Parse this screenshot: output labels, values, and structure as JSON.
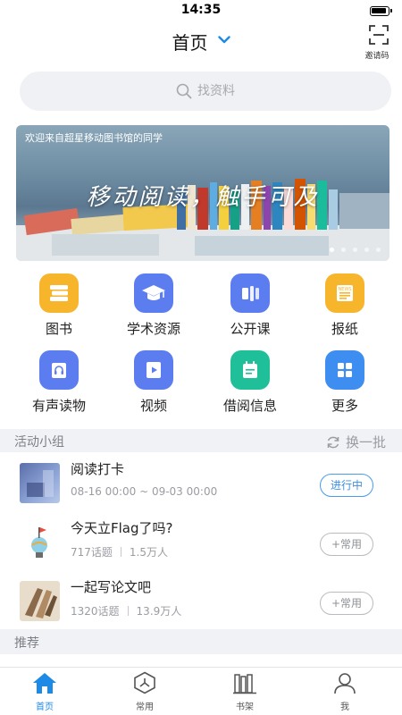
{
  "status_bar": {
    "time": "14:35"
  },
  "nav": {
    "title": "首页",
    "invite_label": "邀请码"
  },
  "search": {
    "placeholder": "找资料"
  },
  "banner": {
    "caption": "欢迎来自超星移动图书馆的同学",
    "slogan": "移动阅读，触手可及",
    "slide_count": 5,
    "active_slide": 1
  },
  "grid": [
    {
      "label": "图书",
      "icon": "books-stack-icon",
      "color": "#f7b52c"
    },
    {
      "label": "学术资源",
      "icon": "graduation-cap-icon",
      "color": "#5b7df0"
    },
    {
      "label": "公开课",
      "icon": "open-course-icon",
      "color": "#5b7df0"
    },
    {
      "label": "报纸",
      "icon": "newspaper-icon",
      "color": "#f7b52c"
    },
    {
      "label": "有声读物",
      "icon": "audiobook-icon",
      "color": "#5b7df0"
    },
    {
      "label": "视频",
      "icon": "video-play-icon",
      "color": "#5b7df0"
    },
    {
      "label": "借阅信息",
      "icon": "calendar-icon",
      "color": "#1fbf9a"
    },
    {
      "label": "更多",
      "icon": "more-grid-icon",
      "color": "#3d8ef0"
    }
  ],
  "activity_groups": {
    "title": "活动小组",
    "refresh_label": "换一批",
    "items": [
      {
        "name": "阅读打卡",
        "meta": "08-16 00:00 ~ 09-03 00:00",
        "button": "进行中",
        "active": true
      },
      {
        "name": "今天立Flag了吗?",
        "topics": "717话题",
        "members": "1.5万人",
        "button": "+常用",
        "active": false
      },
      {
        "name": "一起写论文吧",
        "topics": "1320话题",
        "members": "13.9万人",
        "button": "+常用",
        "active": false
      }
    ]
  },
  "recommend": {
    "title": "推荐"
  },
  "tab_bar": [
    {
      "label": "首页",
      "icon": "home-icon",
      "active": true
    },
    {
      "label": "常用",
      "icon": "compass-icon",
      "active": false
    },
    {
      "label": "书架",
      "icon": "bookshelf-icon",
      "active": false
    },
    {
      "label": "我",
      "icon": "person-icon",
      "active": false
    }
  ],
  "colors": {
    "accent": "#1d8ae6",
    "active_button": "#3c8fe3",
    "section_bg": "#f1f2f5",
    "search_bg": "#f0f1f4"
  }
}
